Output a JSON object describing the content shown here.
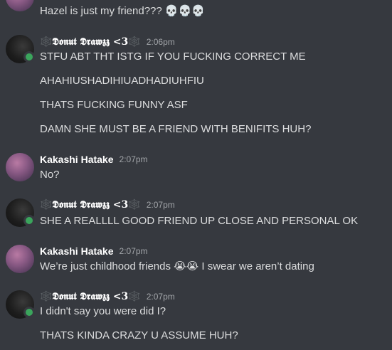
{
  "messages": [
    {
      "author": "",
      "time": "",
      "avatar": "kakashi",
      "lines": [
        "Hazel is just my friend??? 💀💀💀"
      ]
    },
    {
      "author": "🕸️𝕯𝖔𝖓𝖚𝖙 𝕯𝖗𝖆𝖜𝖟𝖟 <3🕸️",
      "time": "2:06pm",
      "avatar": "donut",
      "lines": [
        "STFU ABT THT ISTG IF YOU FUCKING CORRECT ME",
        "AHAHIUSHADIHIUADHADIUHFIU",
        "THATS FUCKING FUNNY ASF",
        "DAMN SHE MUST BE A FRIEND WITH BENIFITS HUH?"
      ]
    },
    {
      "author": "Kakashi Hatake",
      "time": "2:07pm",
      "avatar": "kakashi",
      "lines": [
        "No?"
      ]
    },
    {
      "author": "🕸️𝕯𝖔𝖓𝖚𝖙 𝕯𝖗𝖆𝖜𝖟𝖟 <3🕸️",
      "time": "2:07pm",
      "avatar": "donut",
      "lines": [
        "SHE A REALLLL GOOD FRIEND UP CLOSE AND PERSONAL OK"
      ]
    },
    {
      "author": "Kakashi Hatake",
      "time": "2:07pm",
      "avatar": "kakashi",
      "lines": [
        "We’re just childhood friends 😭😭 I swear we aren’t dating"
      ]
    },
    {
      "author": "🕸️𝕯𝖔𝖓𝖚𝖙 𝕯𝖗𝖆𝖜𝖟𝖟 <3🕸️",
      "time": "2:07pm",
      "avatar": "donut",
      "lines": [
        "I didn't say you were did I?",
        "THATS KINDA CRAZY U ASSUME HUH?"
      ]
    }
  ],
  "colors": {
    "background": "#36393f",
    "text": "#dcddde",
    "username": "#ffffff",
    "timestamp": "#a3a6aa",
    "online": "#3ba55c"
  }
}
